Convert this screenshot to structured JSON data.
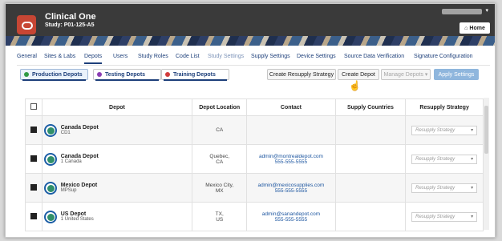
{
  "header": {
    "app": "Clinical One",
    "study": "Study: P01-125-A5",
    "home": "Home"
  },
  "tabs": [
    "General",
    "Sites & Labs",
    "Depots",
    "Users",
    "Study Roles",
    "Code List",
    "Study Settings",
    "Supply Settings",
    "Device Settings",
    "Source Data Verification",
    "Signature Configuration"
  ],
  "depot_types": [
    {
      "label": "Production Depots",
      "color": "#2f9a44"
    },
    {
      "label": "Testing Depots",
      "color": "#8b3db3"
    },
    {
      "label": "Training Depots",
      "color": "#d23b3b"
    }
  ],
  "actions": {
    "create_resupply": "Create Resupply Strategy",
    "create_depot": "Create Depot",
    "manage_depots": "Manage Depots",
    "apply_settings": "Apply Settings"
  },
  "table": {
    "headers": [
      "",
      "Depot",
      "Depot Location",
      "Contact",
      "Supply Countries",
      "Resupply Strategy"
    ],
    "rows": [
      {
        "name": "Canada Depot",
        "sub": "CD1",
        "location1": "CA",
        "location2": "",
        "contact1": "",
        "contact2": "",
        "countries": "",
        "resupply": "Resupply Strategy"
      },
      {
        "name": "Canada Depot",
        "sub": "1 Canada",
        "location1": "Quebec,",
        "location2": "CA",
        "contact1": "admin@montrealdepot.com",
        "contact2": "555-555-5555",
        "countries": "",
        "resupply": "Resupply Strategy"
      },
      {
        "name": "Mexico Depot",
        "sub": "MPSup",
        "location1": "Mexico City,",
        "location2": "MX",
        "contact1": "admin@mexicosupplies.com",
        "contact2": "555-555-5555",
        "countries": "",
        "resupply": "Resupply Strategy"
      },
      {
        "name": "US Depot",
        "sub": "1 United States",
        "location1": "TX,",
        "location2": "US",
        "contact1": "admin@sanandepot.com",
        "contact2": "555-555-5555",
        "countries": "",
        "resupply": "Resupply Strategy"
      }
    ]
  }
}
